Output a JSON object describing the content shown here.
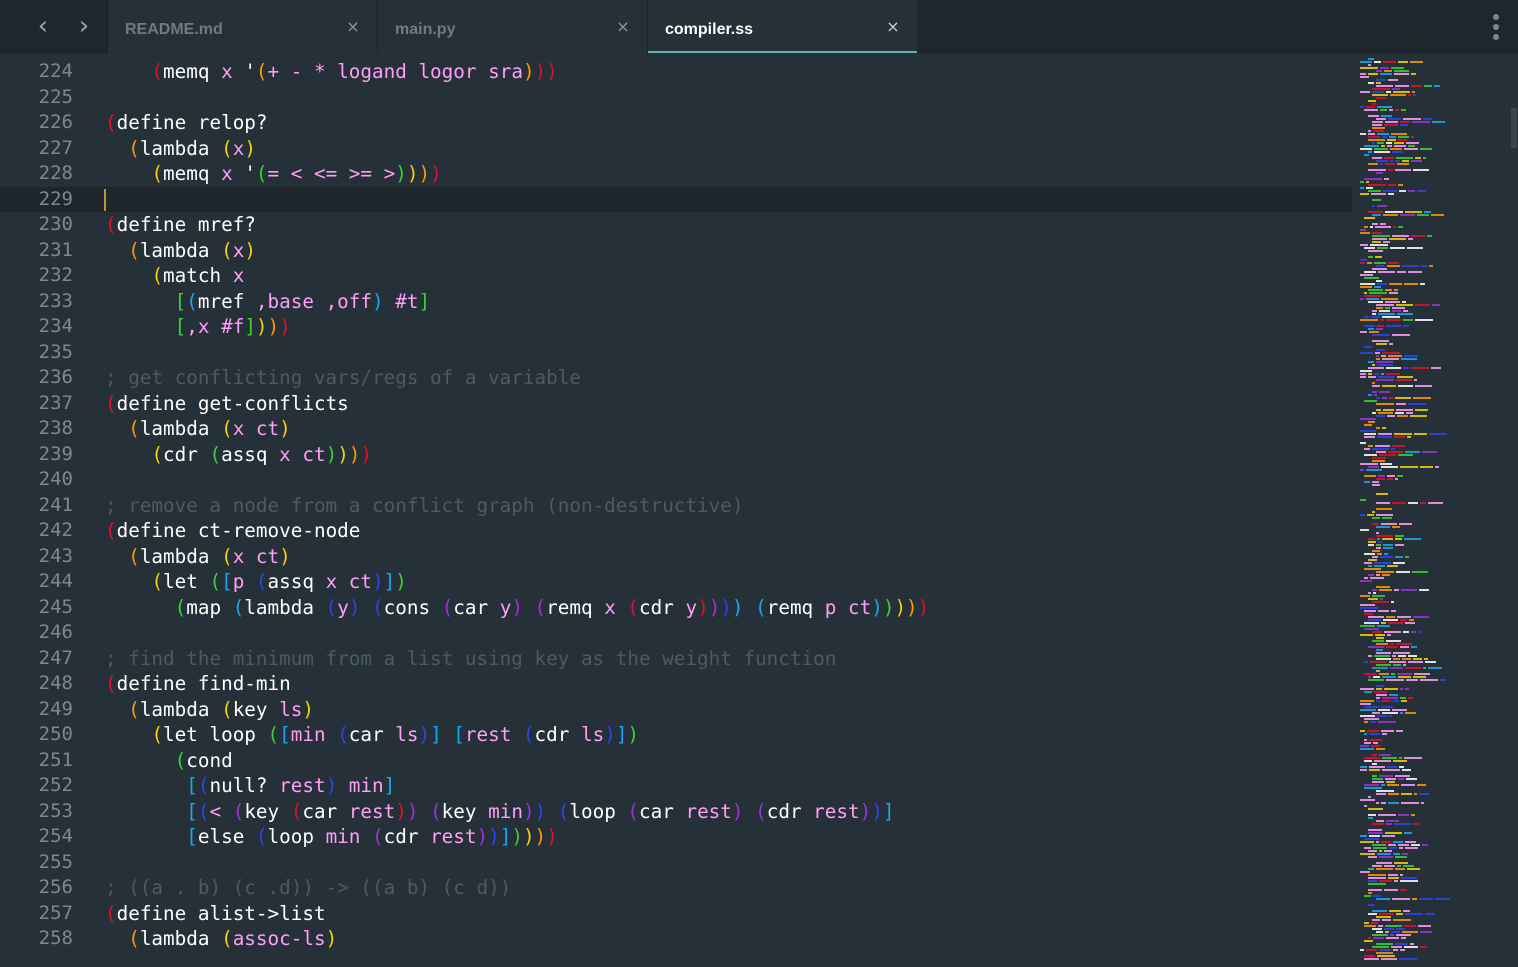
{
  "tabs": [
    {
      "label": "README.md",
      "active": false
    },
    {
      "label": "main.py",
      "active": false
    },
    {
      "label": "compiler.ss",
      "active": true
    }
  ],
  "nav": {
    "back_icon": "chevron-left-icon",
    "forward_icon": "chevron-right-icon",
    "back_glyph": "‹",
    "forward_glyph": "›"
  },
  "tab_close_glyph": "×",
  "menu_icon": "kebab-menu-icon",
  "colors": {
    "background": "#263038",
    "tabbar": "#1f272d",
    "accent_underline": "#5fb3b3",
    "line_number": "#7e8890",
    "comment": "#4c5a63",
    "rainbow": [
      "#e0102c",
      "#ff9a00",
      "#f2d400",
      "#38d430",
      "#18a8f0",
      "#2e44ee",
      "#9a34d6"
    ]
  },
  "editor": {
    "current_line": 229,
    "lines": [
      {
        "n": "224",
        "code": "    (memq x '(+ - * logand logor sra)))"
      },
      {
        "n": "225",
        "code": ""
      },
      {
        "n": "226",
        "code": "(define relop?"
      },
      {
        "n": "227",
        "code": "  (lambda (x)"
      },
      {
        "n": "228",
        "code": "    (memq x '(= < <= >= >))))"
      },
      {
        "n": "229",
        "code": ""
      },
      {
        "n": "230",
        "code": "(define mref?"
      },
      {
        "n": "231",
        "code": "  (lambda (x)"
      },
      {
        "n": "232",
        "code": "    (match x"
      },
      {
        "n": "233",
        "code": "      [(mref ,base ,off) #t]"
      },
      {
        "n": "234",
        "code": "      [,x #f])))"
      },
      {
        "n": "235",
        "code": ""
      },
      {
        "n": "236",
        "code": "; get conflicting vars/regs of a variable"
      },
      {
        "n": "237",
        "code": "(define get-conflicts"
      },
      {
        "n": "238",
        "code": "  (lambda (x ct)"
      },
      {
        "n": "239",
        "code": "    (cdr (assq x ct))))"
      },
      {
        "n": "240",
        "code": ""
      },
      {
        "n": "241",
        "code": "; remove a node from a conflict graph (non-destructive)"
      },
      {
        "n": "242",
        "code": "(define ct-remove-node"
      },
      {
        "n": "243",
        "code": "  (lambda (x ct)"
      },
      {
        "n": "244",
        "code": "    (let ([p (assq x ct)])"
      },
      {
        "n": "245",
        "code": "      (map (lambda (y) (cons (car y) (remq x (cdr y)))) (remq p ct)))))"
      },
      {
        "n": "246",
        "code": ""
      },
      {
        "n": "247",
        "code": "; find the minimum from a list using key as the weight function"
      },
      {
        "n": "248",
        "code": "(define find-min"
      },
      {
        "n": "249",
        "code": "  (lambda (key ls)"
      },
      {
        "n": "250",
        "code": "    (let loop ([min (car ls)] [rest (cdr ls)])"
      },
      {
        "n": "251",
        "code": "      (cond"
      },
      {
        "n": "252",
        "code": "       [(null? rest) min]"
      },
      {
        "n": "253",
        "code": "       [(< (key (car rest)) (key min)) (loop (car rest) (cdr rest))]"
      },
      {
        "n": "254",
        "code": "       [else (loop min (cdr rest))]))))"
      },
      {
        "n": "255",
        "code": ""
      },
      {
        "n": "256",
        "code": "; ((a . b) (c .d)) -> ((a b) (c d))"
      },
      {
        "n": "257",
        "code": "(define alist->list"
      },
      {
        "n": "258",
        "code": "  (lambda (assoc-ls)"
      }
    ]
  },
  "keywords": [
    "define",
    "lambda",
    "let",
    "loop",
    "cond",
    "else",
    "memq",
    "match",
    "mref",
    "car",
    "cdr",
    "cons",
    "map",
    "assq",
    "remq",
    "null?",
    "key",
    "relop?",
    "mref?",
    "get-conflicts",
    "ct-remove-node",
    "find-min",
    "alist->list"
  ]
}
